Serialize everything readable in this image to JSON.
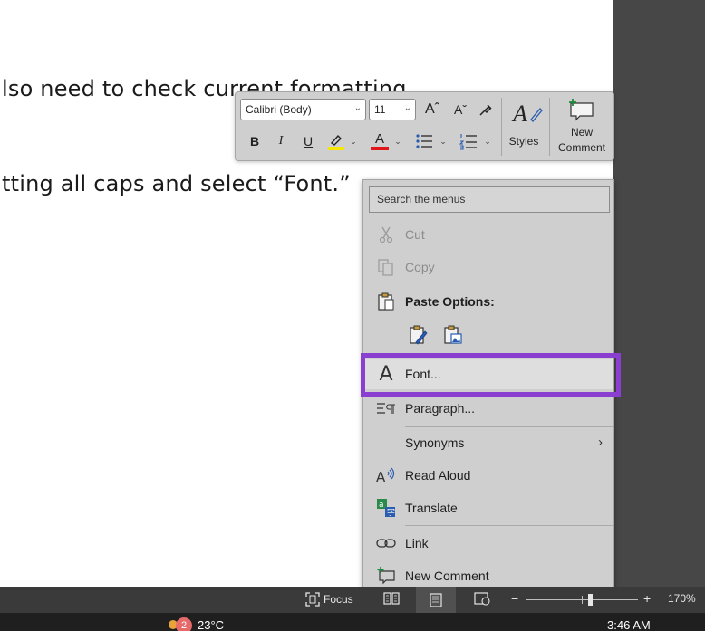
{
  "document": {
    "line1": "lso need to check current formatting",
    "line2": "tting all caps and select “Font.”"
  },
  "mini_toolbar": {
    "font_name": "Calibri (Body)",
    "font_size": "11",
    "grow_font": "Aˆ",
    "shrink_font": "Aˇ",
    "bold": "B",
    "italic": "I",
    "underline": "U",
    "font_color_letter": "A",
    "highlight_color": "#f7e600",
    "font_color": "#e0161b",
    "styles_label": "Styles",
    "new_comment_line1": "New",
    "new_comment_line2": "Comment"
  },
  "context_menu": {
    "search_placeholder": "Search the menus",
    "cut": "Cut",
    "copy": "Copy",
    "paste_options": "Paste Options:",
    "font": "Font...",
    "paragraph": "Paragraph...",
    "synonyms": "Synonyms",
    "read_aloud": "Read Aloud",
    "translate": "Translate",
    "link": "Link",
    "new_comment": "New Comment",
    "highlight_color": "#8a3fd1"
  },
  "status_bar": {
    "focus": "Focus",
    "zoom_minus": "−",
    "zoom_plus": "+",
    "zoom_level": "170%"
  },
  "taskbar": {
    "badge_count": "2",
    "temperature": "23°C",
    "time": "3:46 AM"
  }
}
